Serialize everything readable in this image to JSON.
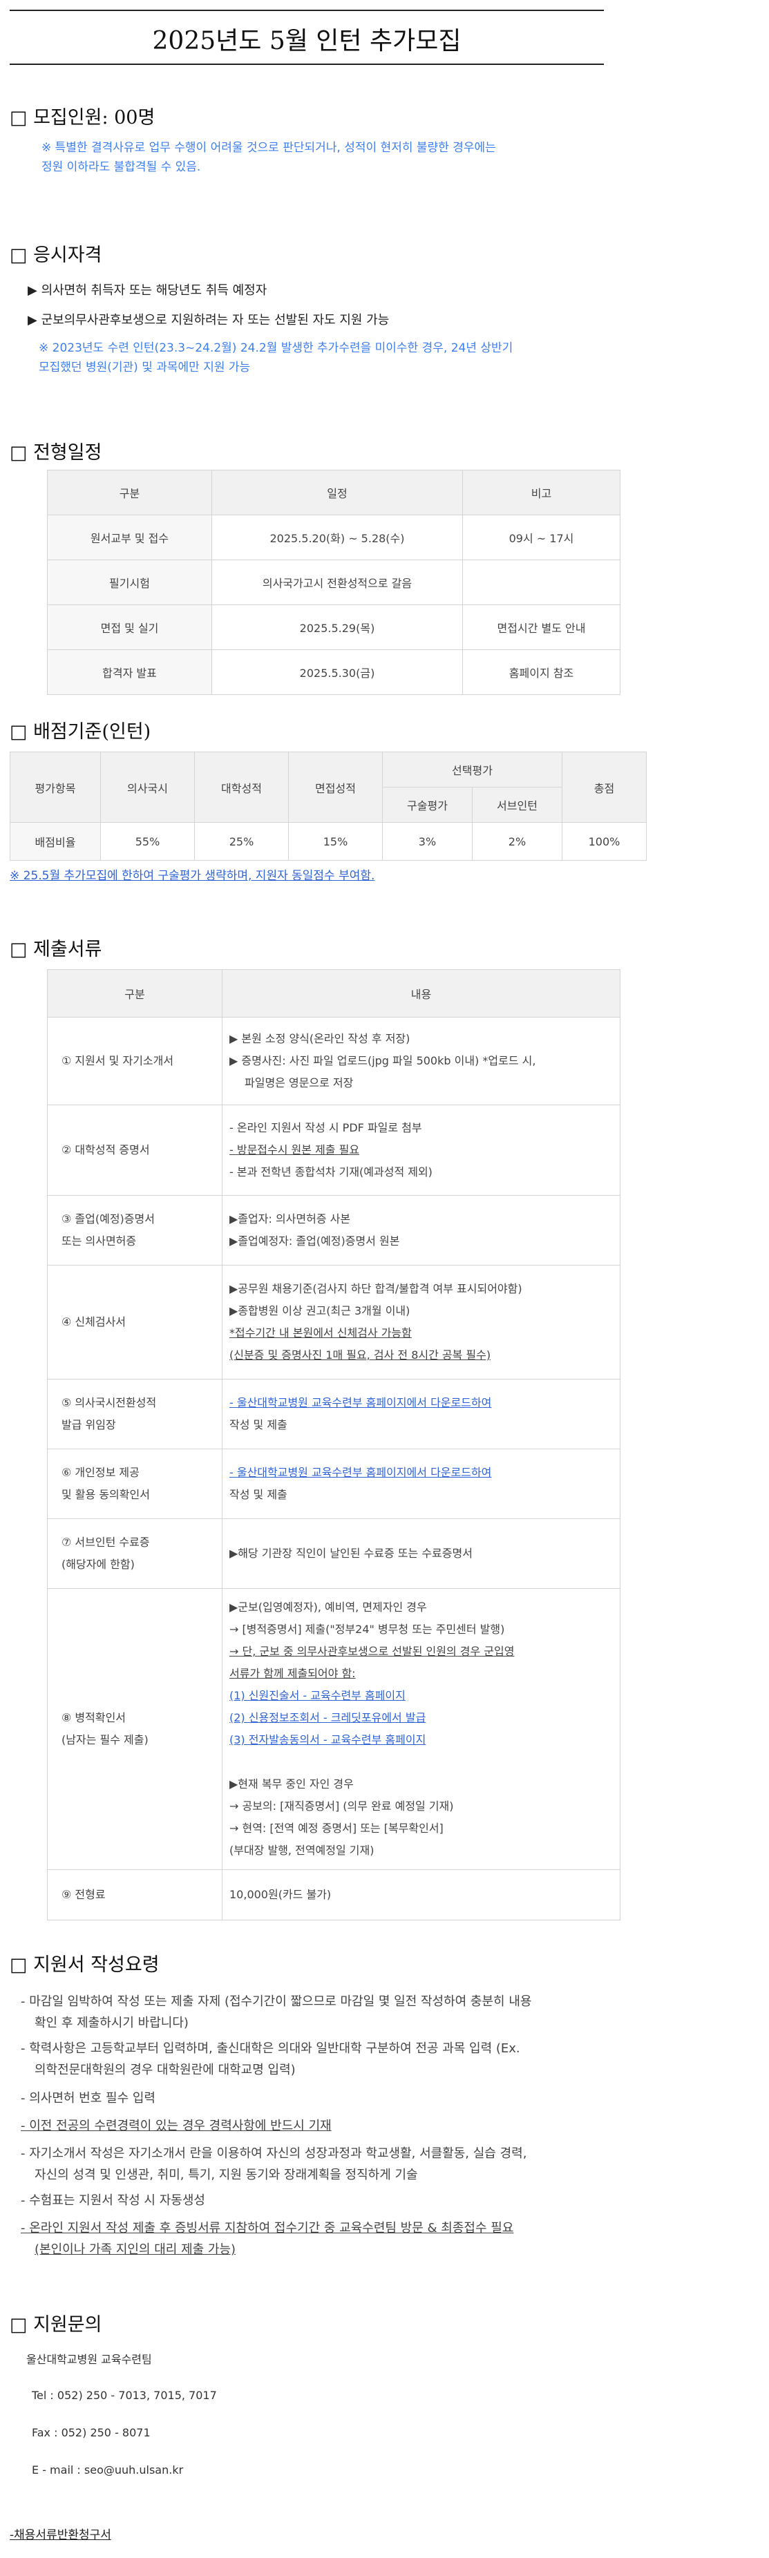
{
  "page": {
    "title": "2025년도 5월 인턴 추가모집"
  },
  "recruit": {
    "heading": "□ 모집인원: 00명",
    "note_line1": "※ 특별한 결격사유로 업무 수행이 어려울 것으로 판단되거나, 성적이 현저히 불량한 경우에는",
    "note_line2": "정원 이하라도 불합격될 수 있음."
  },
  "qualification": {
    "heading": "□ 응시자격",
    "items": [
      "▶ 의사면허 취득자 또는 해당년도 취득 예정자",
      "▶ 군보의무사관후보생으로 지원하려는 자 또는 선발된 자도 지원 가능"
    ],
    "note_line1": "※ 2023년도 수련 인턴(23.3~24.2월) 24.2월 발생한 추가수련을 미이수한 경우, 24년 상반기",
    "note_line2": "모집했던 병원(기관) 및 과목에만 지원 가능"
  },
  "schedule": {
    "heading": "□ 전형일정",
    "headers": [
      "구분",
      "일정",
      "비고"
    ],
    "rows": [
      [
        "원서교부 및 접수",
        "2025.5.20(화) ~ 5.28(수)",
        "09시 ~ 17시"
      ],
      [
        "필기시험",
        "의사국가고시 전환성적으로 갈음",
        ""
      ],
      [
        "면접 및 실기",
        "2025.5.29(목)",
        "면접시간 별도 안내"
      ],
      [
        "합격자 발표",
        "2025.5.30(금)",
        "홈페이지 참조"
      ]
    ]
  },
  "scoring": {
    "heading": "□ 배점기준(인턴)",
    "headers": {
      "item": "평가항목",
      "exam": "의사국시",
      "grade": "대학성적",
      "interview": "면접성적",
      "selective": "선택평가",
      "oral": "구술평가",
      "serve": "서브인턴",
      "total": "총점"
    },
    "row": {
      "label": "배점비율",
      "exam": "55%",
      "grade": "25%",
      "interview": "15%",
      "oral": "3%",
      "serve": "2%",
      "total": "100%"
    },
    "note": "※ 25.5월 추가모집에 한하여 구술평가 생략하며, 지원자 동일점수 부여함."
  },
  "documents": {
    "heading": "□ 제출서류",
    "headers": [
      "구분",
      "내용"
    ],
    "rows": [
      {
        "name": [
          "① 지원서 및 자기소개서"
        ],
        "lines": [
          "▶ 본원 소정 양식(온라인 작성 후 저장)",
          "▶ 증명사진: 사진 파일 업로드(jpg 파일 500kb 이내) *업로드 시,",
          "    파일명은 영문으로 저장"
        ]
      },
      {
        "name": [
          "② 대학성적 증명서"
        ],
        "lines": [
          "- 온라인 지원서 작성 시 PDF 파일로 첨부",
          "- 방문접수시 원본 제출 필요",
          "- 본과 전학년 종합석차 기재(예과성적 제외)"
        ]
      },
      {
        "name": [
          "③ 졸업(예정)증명서",
          "  또는 의사면허증"
        ],
        "lines": [
          "▶졸업자: 의사면허증 사본",
          "▶졸업예정자: 졸업(예정)증명서 원본"
        ]
      },
      {
        "name": [
          "④ 신체검사서"
        ],
        "lines": [
          "▶공무원 채용기준(검사지 하단 합격/불합격 여부 표시되어야함)",
          "▶종합병원 이상 권고(최근 3개월 이내)",
          "*접수기간 내 본원에서 신체검사 가능함",
          "(신분증 및 증명사진 1매 필요, 검사 전 8시간 공복 필수)"
        ]
      },
      {
        "name": [
          "⑤ 의사국시전환성적",
          "발급 위임장"
        ],
        "lines": [
          "- 울산대학교병원 교육수련부 홈페이지에서 다운로드하여",
          "작성 및 제출"
        ]
      },
      {
        "name": [
          "⑥ 개인정보 제공",
          "   및 활용 동의확인서"
        ],
        "lines": [
          "- 울산대학교병원 교육수련부 홈페이지에서 다운로드하여",
          "작성 및 제출"
        ]
      },
      {
        "name": [
          "⑦ 서브인턴 수료증",
          "   (해당자에 한함)"
        ],
        "lines": [
          "▶해당 기관장 직인이 날인된 수료증 또는 수료증명서"
        ]
      },
      {
        "name": [
          "⑧ 병적확인서",
          "(남자는 필수 제출)"
        ],
        "lines": [
          "▶군보(입영예정자), 예비역, 면제자인 경우",
          "  → [병적증명서] 제출(\"정부24\" 병무청 또는 주민센터 발행)",
          "  → 단, 군보 중 의무사관후보생으로 선발된 인원의 경우 군입영",
          "  서류가 함께 제출되어야 함:",
          "  (1) 신원진술서 - 교육수련부 홈페이지",
          "  (2) 신용정보조회서 - 크레딧포유에서 발급",
          "  (3) 전자발송동의서 - 교육수련부 홈페이지",
          "",
          "▶현재 복무 중인 자인 경우",
          "  → 공보의: [재직증명서] (의무 완료 예정일 기재)",
          "  → 현역: [전역 예정 증명서] 또는 [복무확인서]",
          "  (부대장 발행, 전역예정일 기재)"
        ]
      },
      {
        "name": [
          "⑨ 전형료"
        ],
        "lines": [
          "10,000원(카드 불가)"
        ]
      }
    ]
  },
  "writing": {
    "heading": "□ 지원서 작성요령",
    "items": [
      [
        "- 마감일 임박하여 작성 또는 제출 자제 (접수기간이 짧으므로 마감일 몇 일전 작성하여 충분히 내용",
        "확인 후 제출하시기 바랍니다)"
      ],
      [
        "- 학력사항은 고등학교부터 입력하며, 출신대학은 의대와 일반대학 구분하여 전공 과목 입력 (Ex.",
        "의학전문대학원의 경우 대학원란에 대학교명 입력)"
      ],
      [
        "- 의사면허 번호 필수 입력"
      ],
      [
        "- 이전 전공의 수련경력이 있는 경우 경력사항에 반드시 기재"
      ],
      [
        "- 자기소개서 작성은 자기소개서 란을 이용하여 자신의 성장과정과 학교생활, 서클활동, 실습 경력,",
        "자신의 성격 및 인생관, 취미, 특기, 지원 동기와 장래계획을 정직하게 기술"
      ],
      [
        "- 수험표는 지원서 작성 시 자동생성"
      ],
      [
        "- 온라인 지원서 작성 제출 후 증빙서류 지참하여 접수기간 중 교육수련팀 방문 & 최종접수 필요",
        "(본인이나 가족 지인의 대리 제출 가능)"
      ]
    ]
  },
  "contact": {
    "heading": "□ 지원문의",
    "org": "울산대학교병원 교육수련팀",
    "tel": "Tel : 052) 250 - 7013, 7015, 7017",
    "fax": "Fax : 052) 250 - 8071",
    "email": "E - mail : seo@uuh.ulsan.kr"
  },
  "footer": {
    "link": "-채용서류반환청구서"
  }
}
